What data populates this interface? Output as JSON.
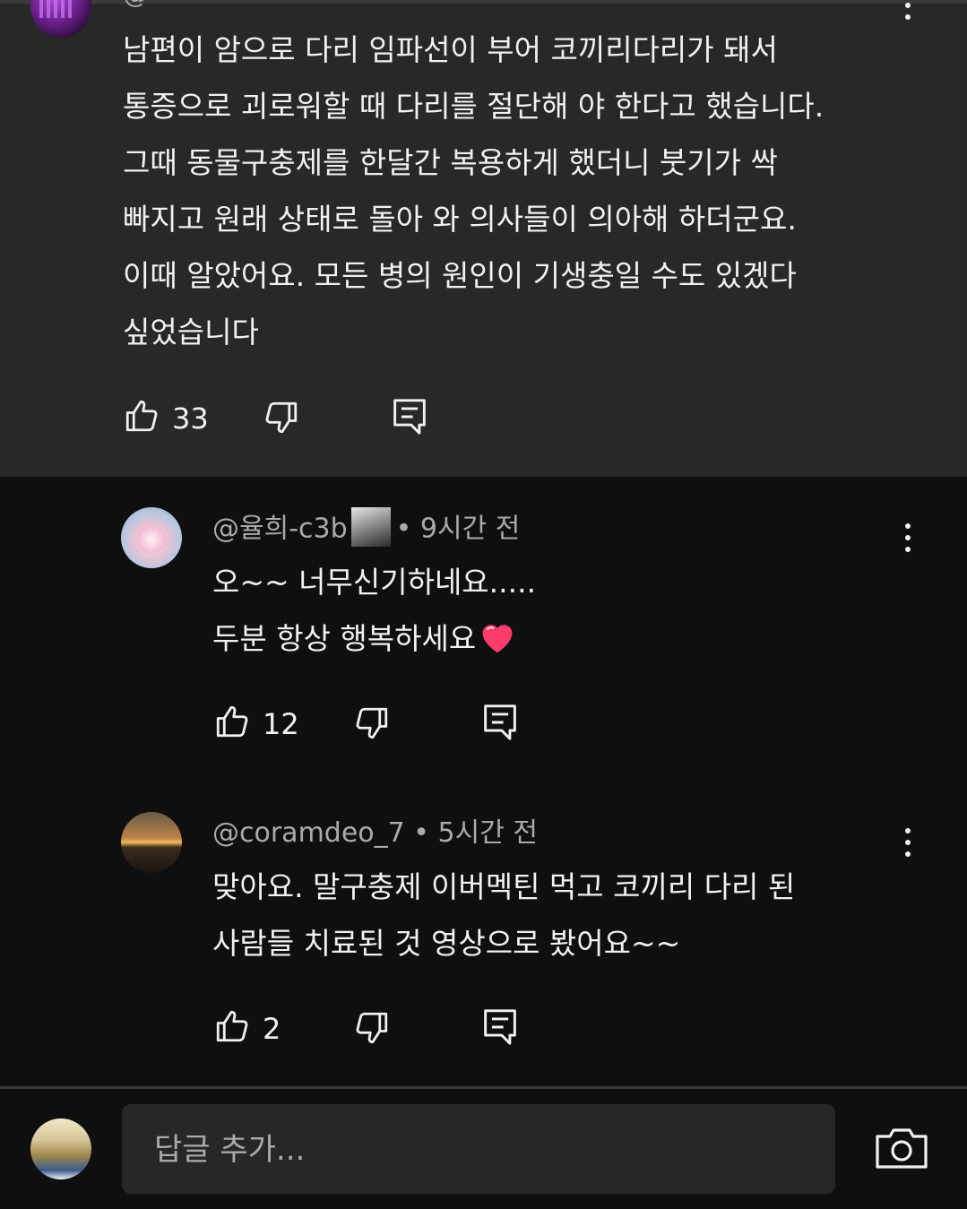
{
  "parent_comment": {
    "header_partial": "@",
    "text": "남편이 암으로 다리 임파선이 부어 코끼리다리가 돼서\n통증으로 괴로워할 때 다리를 절단해 야 한다고 했습니다.\n그때 동물구충제를 한달간 복용하게 했더니 붓기가 싹\n빠지고 원래 상태로 돌아 와 의사들이 의아해 하더군요.\n이때 알았어요.  모든 병의 원인이 기생충일 수도 있겠다\n싶었습니다",
    "likes": "33",
    "icons": [
      "avatar",
      "more-vert-icon",
      "thumb-up-icon",
      "thumb-down-icon",
      "reply-icon"
    ]
  },
  "replies": [
    {
      "handle": "@율희-c3b",
      "time": "• 9시간 전",
      "text": "오~~   너무신기하네요.....\n두분 항상 행복하세요",
      "emoji": "heart-emoji",
      "likes": "12"
    },
    {
      "handle": "@coramdeo_7",
      "time": "• 5시간 전",
      "text": "맞아요. 말구충제 이버멕틴 먹고 코끼리 다리 된\n사람들 치료된 것 영상으로 봤어요~~",
      "likes": "2"
    }
  ],
  "reply_input": {
    "placeholder": "답글 추가..."
  },
  "colors": {
    "background": "#0f0f0f",
    "highlight": "#282828",
    "text": "#f1f1f1",
    "secondary": "#aaaaaa",
    "heart": "#ff3b6b"
  }
}
